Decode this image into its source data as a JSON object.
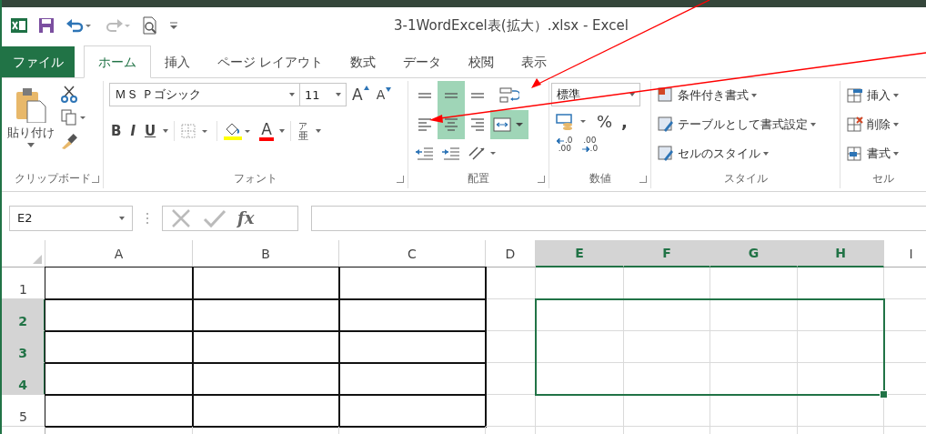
{
  "title": "3-1WordExcel表(拡大）.xlsx - Excel",
  "tabs": [
    {
      "label": "ファイル",
      "kind": "file",
      "selected": false
    },
    {
      "label": "ホーム",
      "kind": "tab",
      "selected": true
    },
    {
      "label": "挿入",
      "kind": "tab",
      "selected": false
    },
    {
      "label": "ページ レイアウト",
      "kind": "tab",
      "selected": false
    },
    {
      "label": "数式",
      "kind": "tab",
      "selected": false
    },
    {
      "label": "データ",
      "kind": "tab",
      "selected": false
    },
    {
      "label": "校閲",
      "kind": "tab",
      "selected": false
    },
    {
      "label": "表示",
      "kind": "tab",
      "selected": false
    }
  ],
  "clipboard": {
    "paste": "貼り付け",
    "label": "クリップボード"
  },
  "font": {
    "name": "ＭＳ Ｐゴシック",
    "size": "11",
    "grow": "A",
    "shrink": "A",
    "bold": "B",
    "italic": "I",
    "underline": "U",
    "color_letter": "A",
    "phonetic_top": "ア",
    "phonetic_bottom": "亜",
    "label": "フォント"
  },
  "alignment": {
    "label": "配置",
    "buttons": [
      {
        "kind": "top",
        "on": false
      },
      {
        "kind": "middle",
        "on": true
      },
      {
        "kind": "bottom",
        "on": false
      },
      {
        "kind": "wrap",
        "on": false
      },
      {
        "kind": "left",
        "on": false
      },
      {
        "kind": "center",
        "on": true
      },
      {
        "kind": "right",
        "on": false
      },
      {
        "kind": "merge",
        "on": true
      },
      {
        "kind": "outdent",
        "on": false
      },
      {
        "kind": "indent",
        "on": false
      },
      {
        "kind": "orientation",
        "on": false
      }
    ]
  },
  "number": {
    "format": "標準",
    "percent": "%",
    "comma": ",",
    "inc_top": ".0",
    "inc_bottom": ".00",
    "dec_top": ".00",
    "dec_bottom": ".0",
    "label": "数値"
  },
  "styles": {
    "items": [
      "条件付き書式",
      "テーブルとして書式設定",
      "セルのスタイル"
    ],
    "label": "スタイル"
  },
  "cells": {
    "items": [
      "挿入",
      "削除",
      "書式"
    ],
    "label": "セル"
  },
  "name_box": "E2",
  "fx": "fx",
  "columns": [
    {
      "label": "A",
      "selected": false,
      "bordered": true
    },
    {
      "label": "B",
      "selected": false,
      "bordered": true
    },
    {
      "label": "C",
      "selected": false,
      "bordered": true
    },
    {
      "label": "D",
      "selected": false,
      "bordered": false
    },
    {
      "label": "E",
      "selected": true,
      "bordered": false
    },
    {
      "label": "F",
      "selected": true,
      "bordered": false
    },
    {
      "label": "G",
      "selected": true,
      "bordered": false
    },
    {
      "label": "H",
      "selected": true,
      "bordered": false
    },
    {
      "label": "I",
      "selected": false,
      "bordered": false
    }
  ],
  "rows": [
    {
      "label": "1",
      "selected": false,
      "bordered": true
    },
    {
      "label": "2",
      "selected": true,
      "bordered": true
    },
    {
      "label": "3",
      "selected": true,
      "bordered": true
    },
    {
      "label": "4",
      "selected": true,
      "bordered": true
    },
    {
      "label": "5",
      "selected": false,
      "bordered": true
    }
  ]
}
